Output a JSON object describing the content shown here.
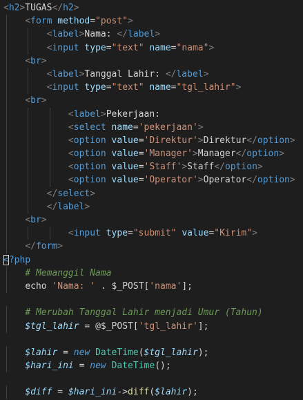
{
  "editor": {
    "background": "#1e1e1e",
    "lines": [
      [
        [
          "t-punc",
          "<"
        ],
        [
          "t-tag",
          "h2"
        ],
        [
          "t-punc",
          ">"
        ],
        [
          "t-text",
          "TUGAS"
        ],
        [
          "t-punc",
          "</"
        ],
        [
          "t-tag",
          "h2"
        ],
        [
          "t-punc",
          ">"
        ]
      ],
      [
        [
          "t-plain",
          "    "
        ],
        [
          "t-punc",
          "<"
        ],
        [
          "t-tag",
          "form"
        ],
        [
          "t-plain",
          " "
        ],
        [
          "t-attr",
          "method"
        ],
        [
          "t-plain",
          "="
        ],
        [
          "t-str",
          "\"post\""
        ],
        [
          "t-punc",
          ">"
        ]
      ],
      [
        [
          "t-plain",
          "        "
        ],
        [
          "t-punc",
          "<"
        ],
        [
          "t-tag",
          "label"
        ],
        [
          "t-punc",
          ">"
        ],
        [
          "t-text",
          "Nama: "
        ],
        [
          "t-punc",
          "</"
        ],
        [
          "t-tag",
          "label"
        ],
        [
          "t-punc",
          ">"
        ]
      ],
      [
        [
          "t-plain",
          "        "
        ],
        [
          "t-punc",
          "<"
        ],
        [
          "t-tag",
          "input"
        ],
        [
          "t-plain",
          " "
        ],
        [
          "t-attr",
          "type"
        ],
        [
          "t-plain",
          "="
        ],
        [
          "t-str",
          "\"text\""
        ],
        [
          "t-plain",
          " "
        ],
        [
          "t-attr",
          "name"
        ],
        [
          "t-plain",
          "="
        ],
        [
          "t-str",
          "\"nama\""
        ],
        [
          "t-punc",
          ">"
        ]
      ],
      [
        [
          "t-plain",
          "    "
        ],
        [
          "t-punc",
          "<"
        ],
        [
          "t-tag",
          "br"
        ],
        [
          "t-punc",
          ">"
        ]
      ],
      [
        [
          "t-plain",
          "        "
        ],
        [
          "t-punc",
          "<"
        ],
        [
          "t-tag",
          "label"
        ],
        [
          "t-punc",
          ">"
        ],
        [
          "t-text",
          "Tanggal Lahir: "
        ],
        [
          "t-punc",
          "</"
        ],
        [
          "t-tag",
          "label"
        ],
        [
          "t-punc",
          ">"
        ]
      ],
      [
        [
          "t-plain",
          "        "
        ],
        [
          "t-punc",
          "<"
        ],
        [
          "t-tag",
          "input"
        ],
        [
          "t-plain",
          " "
        ],
        [
          "t-attr",
          "type"
        ],
        [
          "t-plain",
          "="
        ],
        [
          "t-str",
          "\"text\""
        ],
        [
          "t-plain",
          " "
        ],
        [
          "t-attr",
          "name"
        ],
        [
          "t-plain",
          "="
        ],
        [
          "t-str",
          "\"tgl_lahir\""
        ],
        [
          "t-punc",
          ">"
        ]
      ],
      [
        [
          "t-plain",
          "    "
        ],
        [
          "t-punc",
          "<"
        ],
        [
          "t-tag",
          "br"
        ],
        [
          "t-punc",
          ">"
        ]
      ],
      [
        [
          "t-plain",
          "            "
        ],
        [
          "t-punc",
          "<"
        ],
        [
          "t-tag",
          "label"
        ],
        [
          "t-punc",
          ">"
        ],
        [
          "t-text",
          "Pekerjaan:"
        ]
      ],
      [
        [
          "t-plain",
          "            "
        ],
        [
          "t-punc",
          "<"
        ],
        [
          "t-tag",
          "select"
        ],
        [
          "t-plain",
          " "
        ],
        [
          "t-attr",
          "name"
        ],
        [
          "t-plain",
          "="
        ],
        [
          "t-str",
          "'pekerjaan'"
        ],
        [
          "t-punc",
          ">"
        ]
      ],
      [
        [
          "t-plain",
          "            "
        ],
        [
          "t-punc",
          "<"
        ],
        [
          "t-tag",
          "option"
        ],
        [
          "t-plain",
          " "
        ],
        [
          "t-attr",
          "value"
        ],
        [
          "t-plain",
          "="
        ],
        [
          "t-str",
          "'Direktur'"
        ],
        [
          "t-punc",
          ">"
        ],
        [
          "t-text",
          "Direktur"
        ],
        [
          "t-punc",
          "</"
        ],
        [
          "t-tag",
          "option"
        ],
        [
          "t-punc",
          ">"
        ]
      ],
      [
        [
          "t-plain",
          "            "
        ],
        [
          "t-punc",
          "<"
        ],
        [
          "t-tag",
          "option"
        ],
        [
          "t-plain",
          " "
        ],
        [
          "t-attr",
          "value"
        ],
        [
          "t-plain",
          "="
        ],
        [
          "t-str",
          "'Manager'"
        ],
        [
          "t-punc",
          ">"
        ],
        [
          "t-text",
          "Manager"
        ],
        [
          "t-punc",
          "</"
        ],
        [
          "t-tag",
          "option"
        ],
        [
          "t-punc",
          ">"
        ]
      ],
      [
        [
          "t-plain",
          "            "
        ],
        [
          "t-punc",
          "<"
        ],
        [
          "t-tag",
          "option"
        ],
        [
          "t-plain",
          " "
        ],
        [
          "t-attr",
          "value"
        ],
        [
          "t-plain",
          "="
        ],
        [
          "t-str",
          "'Staff'"
        ],
        [
          "t-punc",
          ">"
        ],
        [
          "t-text",
          "Staff"
        ],
        [
          "t-punc",
          "</"
        ],
        [
          "t-tag",
          "option"
        ],
        [
          "t-punc",
          ">"
        ]
      ],
      [
        [
          "t-plain",
          "            "
        ],
        [
          "t-punc",
          "<"
        ],
        [
          "t-tag",
          "option"
        ],
        [
          "t-plain",
          " "
        ],
        [
          "t-attr",
          "value"
        ],
        [
          "t-plain",
          "="
        ],
        [
          "t-str",
          "'Operator'"
        ],
        [
          "t-punc",
          ">"
        ],
        [
          "t-text",
          "Operator"
        ],
        [
          "t-punc",
          "</"
        ],
        [
          "t-tag",
          "option"
        ],
        [
          "t-punc",
          ">"
        ]
      ],
      [
        [
          "t-plain",
          "        "
        ],
        [
          "t-punc",
          "</"
        ],
        [
          "t-tag",
          "select"
        ],
        [
          "t-punc",
          ">"
        ]
      ],
      [
        [
          "t-plain",
          "        "
        ],
        [
          "t-punc",
          "</"
        ],
        [
          "t-tag",
          "label"
        ],
        [
          "t-punc",
          ">"
        ]
      ],
      [
        [
          "t-plain",
          "    "
        ],
        [
          "t-punc",
          "<"
        ],
        [
          "t-tag",
          "br"
        ],
        [
          "t-punc",
          ">"
        ]
      ],
      [
        [
          "t-plain",
          "            "
        ],
        [
          "t-punc",
          "<"
        ],
        [
          "t-tag",
          "input"
        ],
        [
          "t-plain",
          " "
        ],
        [
          "t-attr",
          "type"
        ],
        [
          "t-plain",
          "="
        ],
        [
          "t-str",
          "\"submit\""
        ],
        [
          "t-plain",
          " "
        ],
        [
          "t-attr",
          "value"
        ],
        [
          "t-plain",
          "="
        ],
        [
          "t-str",
          "\"Kirim\""
        ],
        [
          "t-punc",
          ">"
        ]
      ],
      [
        [
          "t-plain",
          "    "
        ],
        [
          "t-punc",
          "</"
        ],
        [
          "t-tag",
          "form"
        ],
        [
          "t-punc",
          ">"
        ]
      ],
      [
        [
          "t-php",
          "<?php"
        ]
      ],
      [
        [
          "t-plain",
          "    "
        ],
        [
          "t-comment",
          "# Memanggil Nama"
        ]
      ],
      [
        [
          "t-plain",
          "    "
        ],
        [
          "t-plain",
          "echo "
        ],
        [
          "t-str",
          "'Nama: '"
        ],
        [
          "t-plain",
          " . $_POST["
        ],
        [
          "t-str",
          "'nama'"
        ],
        [
          "t-plain",
          "];"
        ]
      ],
      [],
      [
        [
          "t-plain",
          "    "
        ],
        [
          "t-comment",
          "# Merubah Tanggal Lahir menjadi Umur (Tahun)"
        ]
      ],
      [
        [
          "t-plain",
          "    "
        ],
        [
          "t-var",
          "$tgl_lahir"
        ],
        [
          "t-plain",
          " = @$_POST["
        ],
        [
          "t-str",
          "'tgl_lahir'"
        ],
        [
          "t-plain",
          "];"
        ]
      ],
      [],
      [
        [
          "t-plain",
          "    "
        ],
        [
          "t-var",
          "$lahir"
        ],
        [
          "t-plain",
          " = "
        ],
        [
          "t-kw",
          "new"
        ],
        [
          "t-plain",
          " "
        ],
        [
          "t-class",
          "DateTime"
        ],
        [
          "t-plain",
          "("
        ],
        [
          "t-var",
          "$tgl_lahir"
        ],
        [
          "t-plain",
          ");"
        ]
      ],
      [
        [
          "t-plain",
          "    "
        ],
        [
          "t-var",
          "$hari_ini"
        ],
        [
          "t-plain",
          " = "
        ],
        [
          "t-kw",
          "new"
        ],
        [
          "t-plain",
          " "
        ],
        [
          "t-class",
          "DateTime"
        ],
        [
          "t-plain",
          "();"
        ]
      ],
      [],
      [
        [
          "t-plain",
          "    "
        ],
        [
          "t-var",
          "$diff"
        ],
        [
          "t-plain",
          " = "
        ],
        [
          "t-var",
          "$hari_ini"
        ],
        [
          "t-plain",
          "->"
        ],
        [
          "t-func",
          "diff"
        ],
        [
          "t-plain",
          "("
        ],
        [
          "t-var",
          "$lahir"
        ],
        [
          "t-plain",
          ");"
        ]
      ]
    ]
  }
}
